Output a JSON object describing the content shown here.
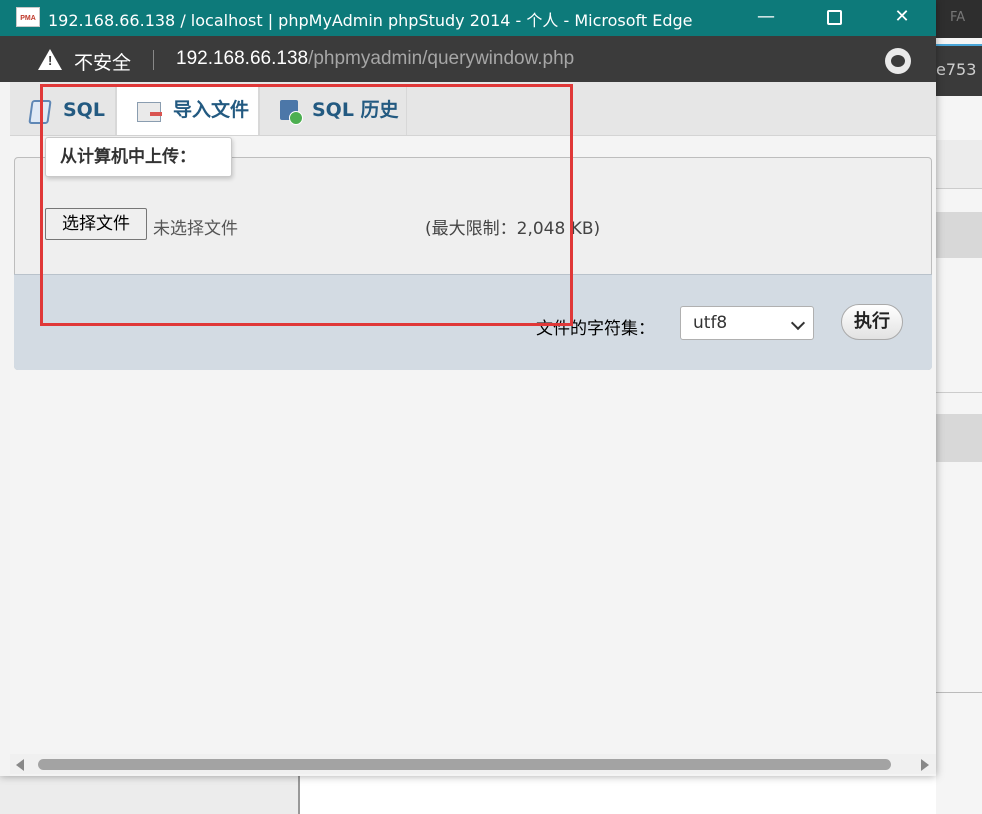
{
  "window": {
    "title": "192.168.66.138 / localhost | phpMyAdmin phpStudy 2014 - 个人 - Microsoft Edge",
    "app_icon_text": "PMA",
    "controls": {
      "minimize": "—",
      "close": "✕"
    }
  },
  "addressbar": {
    "security_label": "不安全",
    "url_host": "192.168.66.138",
    "url_path": "/phpmyadmin/querywindow.php"
  },
  "tabs": [
    {
      "label": "SQL",
      "icon": "sql-icon"
    },
    {
      "label": "导入文件",
      "icon": "import-icon",
      "active": true
    },
    {
      "label": "SQL 历史",
      "icon": "history-icon"
    }
  ],
  "upload": {
    "legend": "从计算机中上传：",
    "choose_button": "选择文件",
    "file_status": "未选择文件",
    "limit": "(最大限制：2,048 KB)"
  },
  "footer": {
    "charset_label": "文件的字符集：",
    "charset_selected": "utf8",
    "go_button": "执行"
  },
  "background": {
    "tab_fragment": "e753",
    "fa_fragment": "FA"
  },
  "colors": {
    "titlebar": "#0d7a7a",
    "addressbar": "#3b3b3b",
    "tab_text": "#235a81",
    "annotation": "#e03838"
  }
}
